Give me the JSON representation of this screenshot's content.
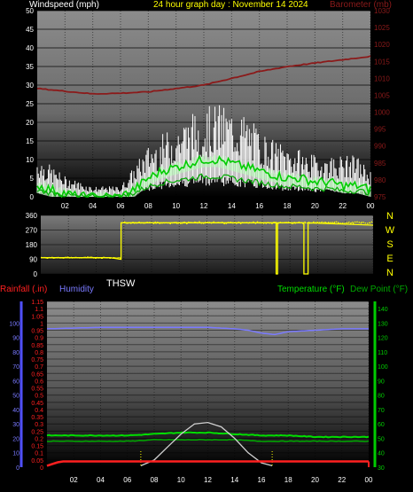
{
  "colors": {
    "wind_label": "#ffffff",
    "title": "#ffff00",
    "barometer": "#8b1a1a",
    "gust": "#ffffff",
    "wind_avg": "#00cc00",
    "wind_band": "#ccffcc",
    "direction": "#ffff00",
    "rainfall": "#ff2020",
    "humidity": "#7a7aff",
    "temperature": "#00dd00",
    "dewpoint": "#00aa00",
    "solar": "#d0d0d0",
    "axis_left_lower": "#5050ff",
    "axis_right_lower": "#00cc00",
    "ticks_top": "#ffffff",
    "ticks_baro": "#8b1a1a"
  },
  "headers": {
    "wind_label": "Windspeed (mph)",
    "title": "24 hour graph day : November 14 2024",
    "barometer_label": "Barometer (mb)",
    "thsw": "THSW",
    "rainfall_label": "Rainfall (.in)",
    "humidity_label": "Humidity",
    "temperature_label": "Temperature (°F)",
    "dewpoint_label": "Dew Point (°F)"
  },
  "compass": [
    "N",
    "W",
    "S",
    "E",
    "N"
  ],
  "chart_data": [
    {
      "type": "line",
      "title": "24 hour graph day : November 14 2024",
      "x_ticks": [
        "02",
        "04",
        "06",
        "08",
        "10",
        "12",
        "14",
        "16",
        "18",
        "20",
        "22",
        "00"
      ],
      "left_axis": {
        "label": "Windspeed (mph)",
        "ticks": [
          0,
          5,
          10,
          15,
          20,
          25,
          30,
          35,
          40,
          45,
          50
        ],
        "range": [
          0,
          50
        ]
      },
      "right_axis": {
        "label": "Barometer (mb)",
        "ticks": [
          975,
          980,
          985,
          990,
          995,
          1000,
          1005,
          1010,
          1015,
          1020,
          1025,
          1030
        ],
        "range": [
          975,
          1030
        ]
      },
      "series": [
        {
          "name": "Barometer",
          "axis": "right",
          "x": [
            0,
            2,
            4,
            6,
            8,
            10,
            12,
            14,
            16,
            18,
            20,
            22,
            24
          ],
          "values": [
            1007,
            1006.2,
            1005.4,
            1005.6,
            1006,
            1007,
            1008,
            1010,
            1012,
            1013.5,
            1014.5,
            1015.5,
            1016.5
          ]
        },
        {
          "name": "Wind Gust",
          "axis": "left",
          "x": [
            0,
            1,
            2,
            3,
            4,
            5,
            6,
            7,
            8,
            9,
            10,
            11,
            12,
            13,
            14,
            15,
            16,
            17,
            18,
            19,
            20,
            21,
            22,
            23,
            24
          ],
          "values": [
            8,
            6,
            4,
            3,
            2,
            2,
            2,
            6,
            10,
            12,
            14,
            16,
            17,
            18,
            17,
            16,
            13,
            11,
            10,
            9,
            8,
            8,
            8,
            8,
            5
          ]
        },
        {
          "name": "Wind Speed",
          "axis": "left",
          "x": [
            0,
            1,
            2,
            3,
            4,
            5,
            6,
            7,
            8,
            9,
            10,
            11,
            12,
            13,
            14,
            15,
            16,
            17,
            18,
            19,
            20,
            21,
            22,
            23,
            24
          ],
          "values": [
            3,
            2,
            1,
            0,
            0,
            0,
            0,
            2,
            5,
            7,
            8,
            9,
            10,
            10,
            9,
            8,
            7,
            6,
            5,
            5,
            4,
            4,
            3,
            3,
            2
          ]
        }
      ]
    },
    {
      "type": "line",
      "left_axis": {
        "ticks": [
          0,
          90,
          180,
          270,
          360
        ],
        "range": [
          0,
          360
        ]
      },
      "series": [
        {
          "name": "Wind Direction",
          "x": [
            0,
            5,
            5.8,
            5.8,
            17,
            17,
            17.1,
            17.1,
            19,
            19,
            19.3,
            19.3,
            24
          ],
          "values": [
            100,
            100,
            90,
            315,
            315,
            0,
            0,
            315,
            315,
            0,
            0,
            315,
            300
          ]
        }
      ]
    },
    {
      "type": "line",
      "x_ticks": [
        "02",
        "04",
        "06",
        "08",
        "10",
        "12",
        "14",
        "16",
        "18",
        "20",
        "22",
        "00"
      ],
      "left_axis": {
        "ticks": [
          0,
          0.05,
          0.1,
          0.15,
          0.2,
          0.25,
          0.3,
          0.35,
          0.4,
          0.45,
          0.5,
          0.55,
          0.6,
          0.65,
          0.7,
          0.75,
          0.8,
          0.85,
          0.9,
          0.95,
          1,
          1.05,
          1.1,
          1.15
        ],
        "humidity_ticks": [
          0,
          10,
          20,
          30,
          40,
          50,
          60,
          70,
          80,
          90,
          100
        ],
        "range": [
          0,
          1.15
        ]
      },
      "right_axis": {
        "ticks": [
          30,
          40,
          50,
          60,
          70,
          80,
          90,
          100,
          110,
          120,
          130,
          140
        ],
        "range": [
          30,
          145
        ]
      },
      "series": [
        {
          "name": "Rainfall",
          "axis": "left",
          "x": [
            0,
            1,
            24
          ],
          "values": [
            0.01,
            0.04,
            0.04
          ]
        },
        {
          "name": "Humidity",
          "axis": "humidity",
          "x": [
            0,
            4,
            8,
            12,
            14,
            15,
            16,
            17,
            18,
            20,
            22,
            24
          ],
          "values": [
            96,
            97,
            97,
            97,
            96,
            95,
            93,
            92,
            94,
            95,
            96,
            96
          ]
        },
        {
          "name": "Temperature",
          "axis": "right",
          "x": [
            0,
            4,
            6,
            8,
            10,
            12,
            14,
            16,
            18,
            20,
            22,
            24
          ],
          "values": [
            52,
            52,
            52,
            53,
            54,
            54,
            53,
            52,
            52,
            51,
            51,
            51
          ]
        },
        {
          "name": "Dew Point",
          "axis": "right",
          "x": [
            0,
            4,
            6,
            8,
            10,
            12,
            14,
            16,
            18,
            20,
            22,
            24
          ],
          "values": [
            48,
            48,
            48,
            49,
            49,
            49,
            49,
            48,
            48,
            48,
            48,
            48
          ]
        },
        {
          "name": "Solar",
          "axis": "right",
          "x": [
            7,
            8,
            9,
            10,
            11,
            12,
            13,
            14,
            15,
            16,
            16.8
          ],
          "values": [
            31,
            35,
            44,
            53,
            60,
            61,
            58,
            50,
            40,
            33,
            31
          ]
        }
      ]
    }
  ]
}
